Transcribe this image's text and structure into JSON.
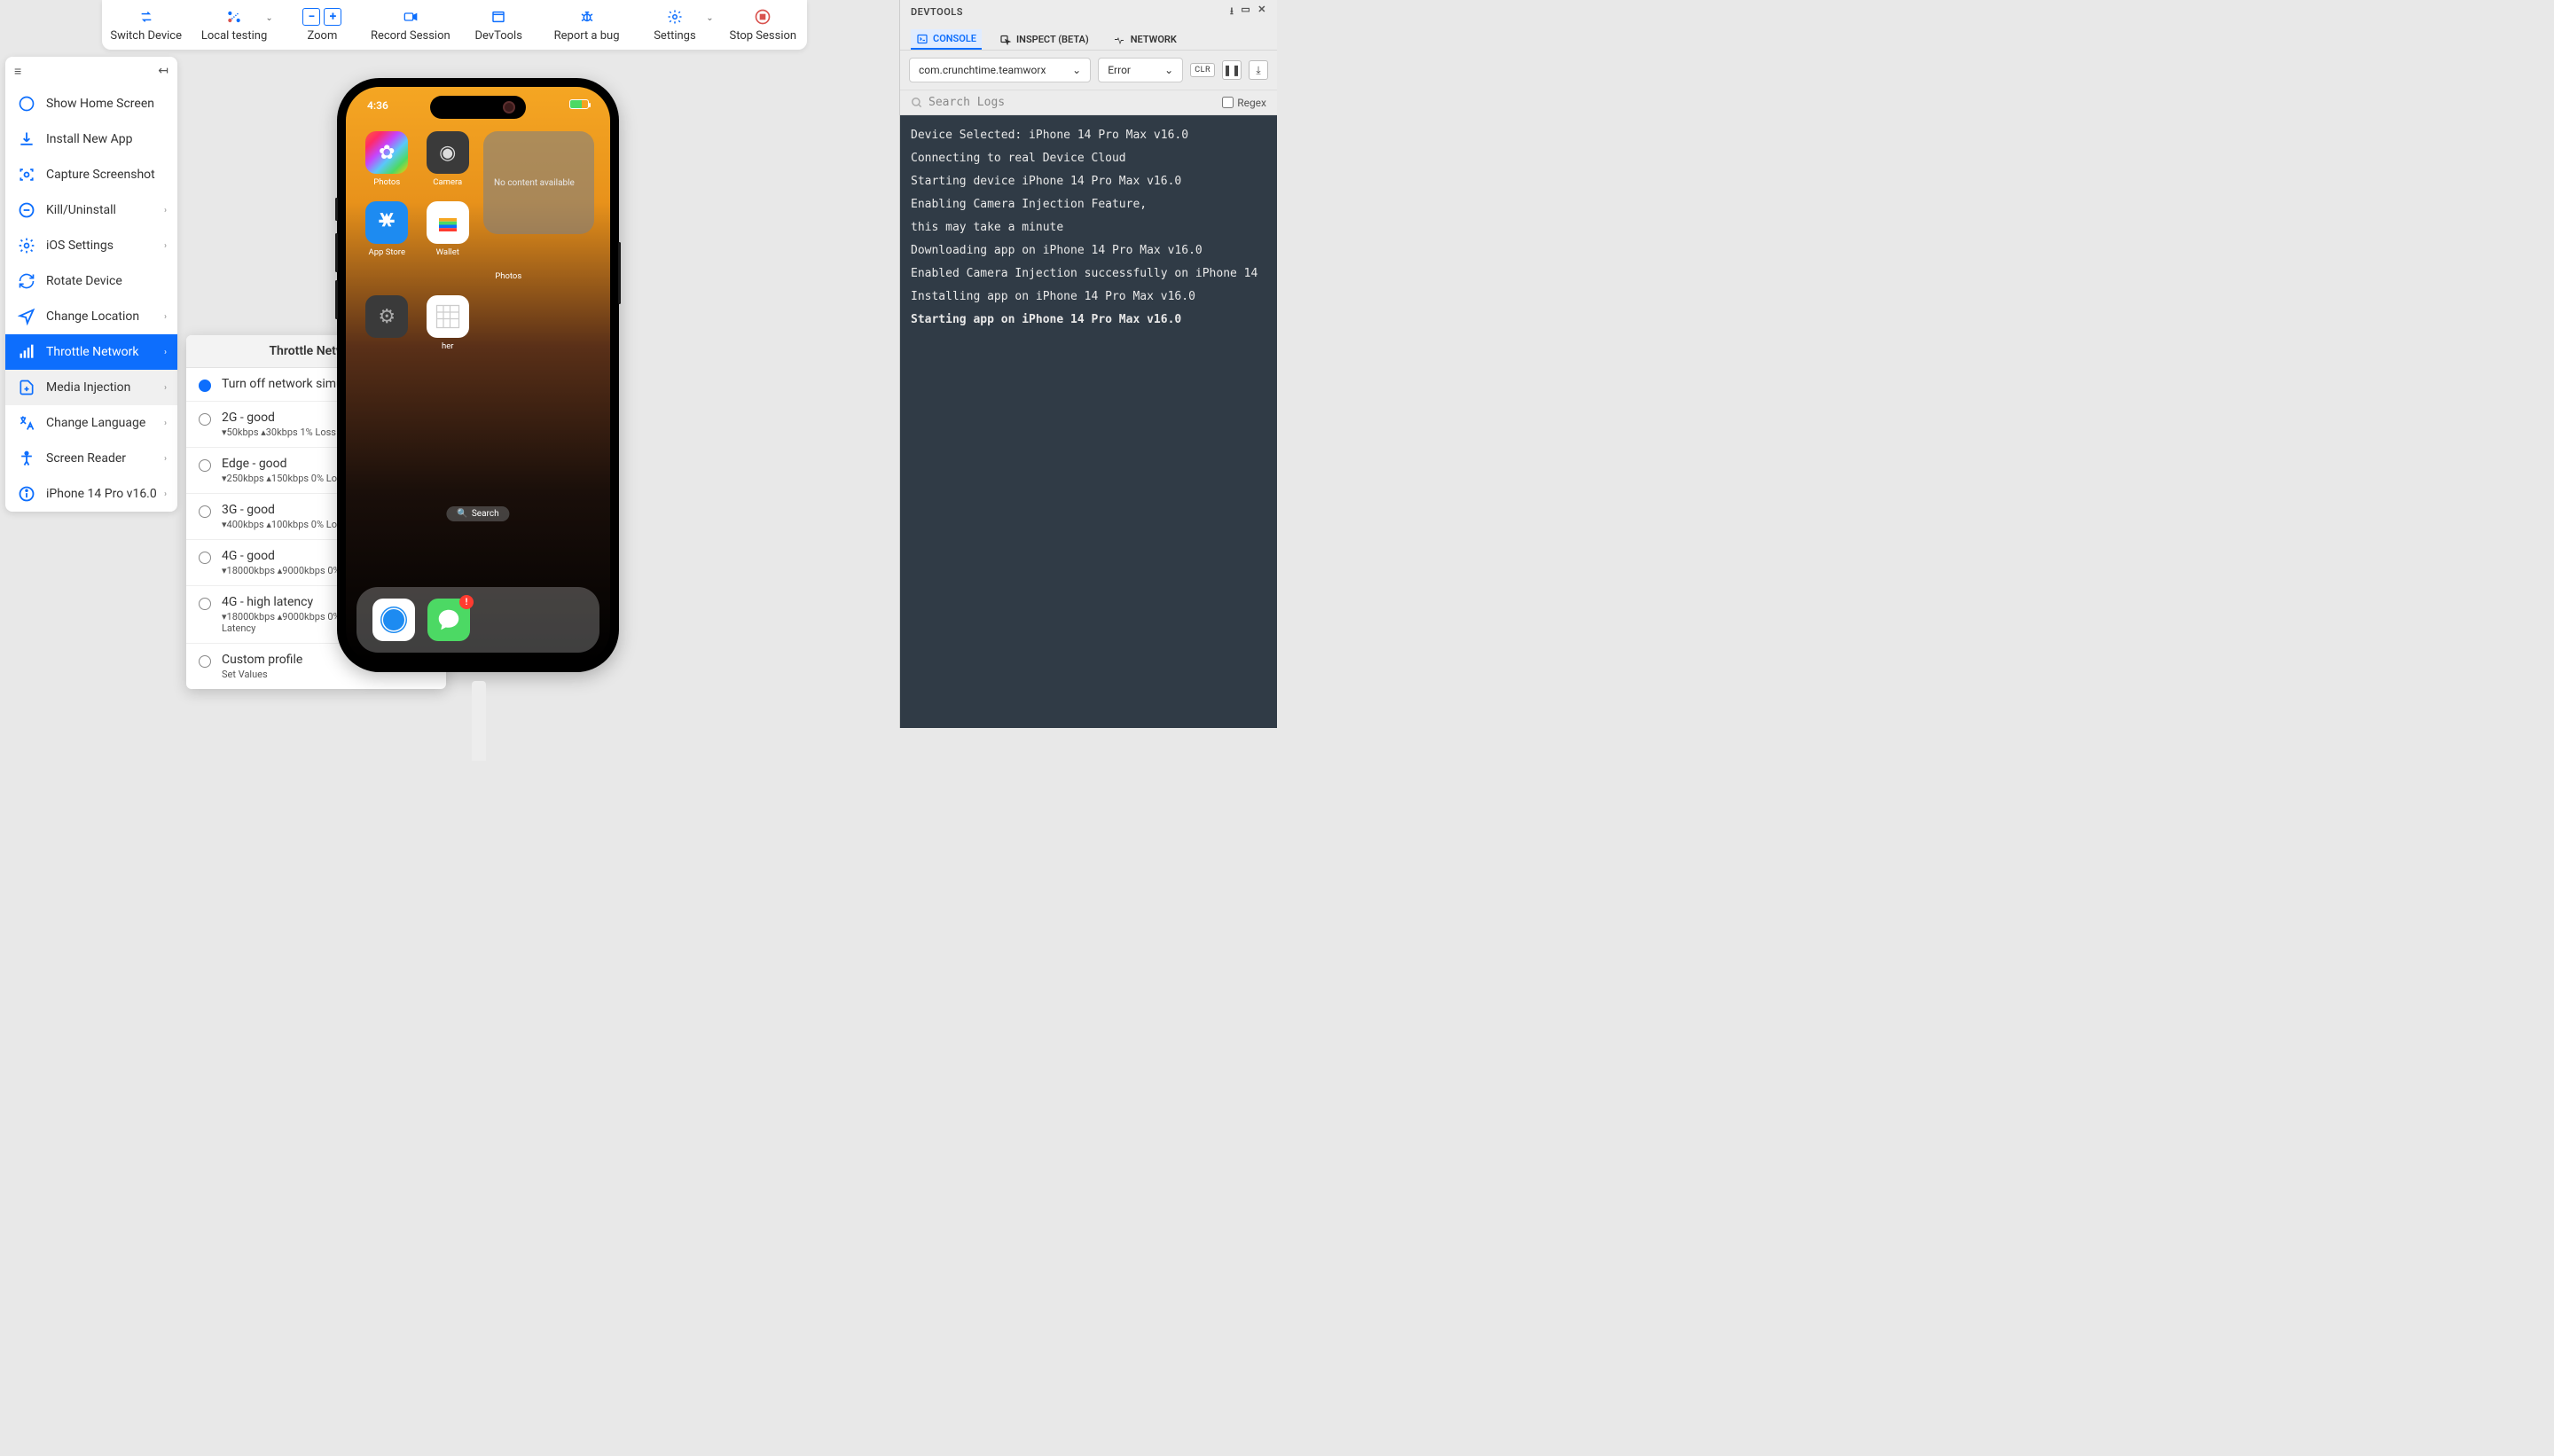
{
  "toolbar": {
    "switch_device": "Switch Device",
    "local_testing": "Local testing",
    "zoom": "Zoom",
    "record_session": "Record Session",
    "devtools": "DevTools",
    "report_bug": "Report a bug",
    "settings": "Settings",
    "stop_session": "Stop Session"
  },
  "sidebar": {
    "items": [
      {
        "label": "Show Home Screen",
        "icon": "home-circle",
        "chevron": false
      },
      {
        "label": "Install New App",
        "icon": "download",
        "chevron": false
      },
      {
        "label": "Capture Screenshot",
        "icon": "capture",
        "chevron": false
      },
      {
        "label": "Kill/Uninstall",
        "icon": "minus-circle",
        "chevron": true
      },
      {
        "label": "iOS Settings",
        "icon": "gear",
        "chevron": true
      },
      {
        "label": "Rotate Device",
        "icon": "rotate",
        "chevron": false
      },
      {
        "label": "Change Location",
        "icon": "location",
        "chevron": true
      },
      {
        "label": "Throttle Network",
        "icon": "network",
        "chevron": true,
        "active": true
      },
      {
        "label": "Media Injection",
        "icon": "file-plus",
        "chevron": true,
        "hover": true
      },
      {
        "label": "Change Language",
        "icon": "language",
        "chevron": true
      },
      {
        "label": "Screen Reader",
        "icon": "accessibility",
        "chevron": true
      },
      {
        "label": "iPhone 14 Pro",
        "version": "v16.0",
        "icon": "info",
        "chevron": true
      }
    ]
  },
  "throttle": {
    "title": "Throttle Network",
    "options": [
      {
        "label": "Turn off network simulation",
        "detail": "",
        "selected": true
      },
      {
        "label": "2G - good",
        "detail": "▾50kbps  ▴30kbps  1% Loss  500ms Latency"
      },
      {
        "label": "Edge - good",
        "detail": "▾250kbps  ▴150kbps  0% Loss  300ms Latency"
      },
      {
        "label": "3G - good",
        "detail": "▾400kbps  ▴100kbps  0% Loss  100ms Latency"
      },
      {
        "label": "4G - good",
        "detail": "▾18000kbps  ▴9000kbps  0% Loss  100ms Latency"
      },
      {
        "label": "4G - high latency",
        "detail": "▾18000kbps  ▴9000kbps  0% Loss  3000ms Latency"
      },
      {
        "label": "Custom profile",
        "detail": "Set Values",
        "edit": true
      }
    ]
  },
  "phone": {
    "time": "4:36",
    "apps": {
      "photos": "Photos",
      "camera": "Camera",
      "appstore": "App Store",
      "wallet": "Wallet",
      "widget_title": "No content available",
      "widget_label": "Photos",
      "settings_suffix": "her"
    },
    "search": "Search",
    "badge": "!"
  },
  "devtools": {
    "title": "DEVTOOLS",
    "tabs": {
      "console": "CONSOLE",
      "inspect": "INSPECT (BETA)",
      "network": "NETWORK"
    },
    "filter_app": "com.crunchtime.teamworx",
    "filter_level": "Error",
    "clr": "CLR",
    "search_placeholder": "Search Logs",
    "regex": "Regex",
    "logs": [
      "Device Selected: iPhone 14 Pro Max v16.0",
      "Connecting to real Device Cloud",
      "Starting device iPhone 14 Pro Max v16.0",
      "Enabling Camera Injection Feature,",
      "this may take a minute",
      "Downloading app on iPhone 14 Pro Max v16.0",
      "Enabled Camera Injection successfully on iPhone 14",
      "Installing app on iPhone 14 Pro Max v16.0"
    ],
    "log_bold": "Starting app on iPhone 14 Pro Max v16.0"
  }
}
